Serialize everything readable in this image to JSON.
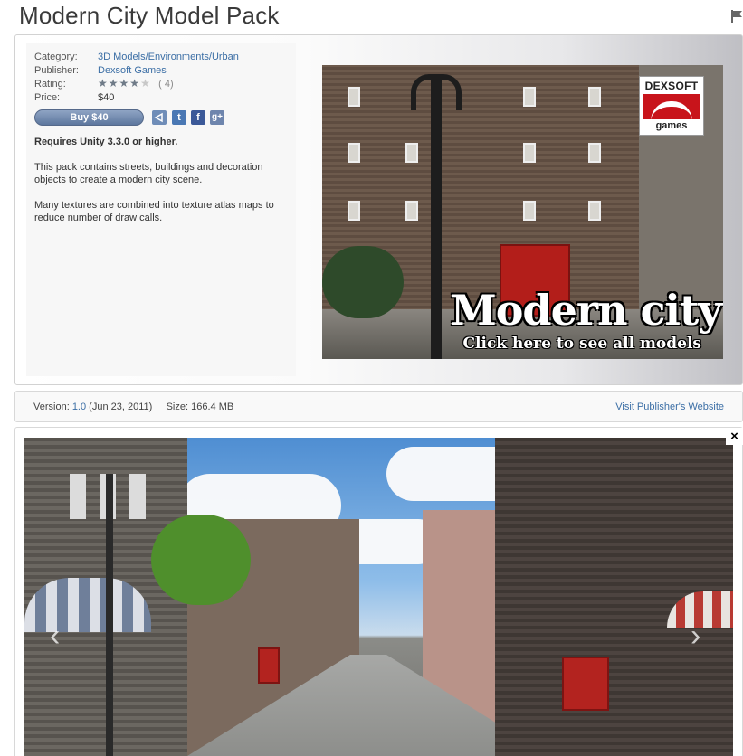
{
  "page": {
    "title": "Modern City Model Pack",
    "flag_icon": "flag-icon"
  },
  "meta": {
    "category_label": "Category:",
    "category_value": "3D Models/Environments/Urban",
    "publisher_label": "Publisher:",
    "publisher_value": "Dexsoft Games",
    "rating_label": "Rating:",
    "rating_stars": 4,
    "rating_max": 5,
    "rating_count": "( 4)",
    "price_label": "Price:",
    "price_value": "$40"
  },
  "actions": {
    "buy_label": "Buy $40",
    "share_icons": [
      "unity-share-icon",
      "twitter-icon",
      "facebook-icon",
      "google-plus-icon"
    ],
    "twitter_glyph": "t",
    "facebook_glyph": "f",
    "google_glyph": "g+"
  },
  "description": {
    "requirement": "Requires Unity 3.3.0 or higher.",
    "paragraph1": "This pack contains streets, buildings and decoration objects to create a modern city scene.",
    "paragraph2": "Many textures are combined into texture atlas maps to reduce number of draw calls."
  },
  "hero": {
    "logo_top": "DEXSOFT",
    "logo_bottom": "games",
    "caption_main": "Modern city",
    "caption_sub": "Click here to see all models"
  },
  "version": {
    "version_label": "Version:",
    "version_value": "1.0",
    "date": "(Jun 23, 2011)",
    "size_label": "Size:",
    "size_value": "166.4 MB",
    "publisher_site": "Visit Publisher's Website"
  },
  "viewer": {
    "prev_glyph": "‹",
    "next_glyph": "›",
    "close_glyph": "×"
  },
  "colors": {
    "link": "#3b6ea5",
    "buy_button": "#6f86ab",
    "share_button": "#4a78b4"
  }
}
